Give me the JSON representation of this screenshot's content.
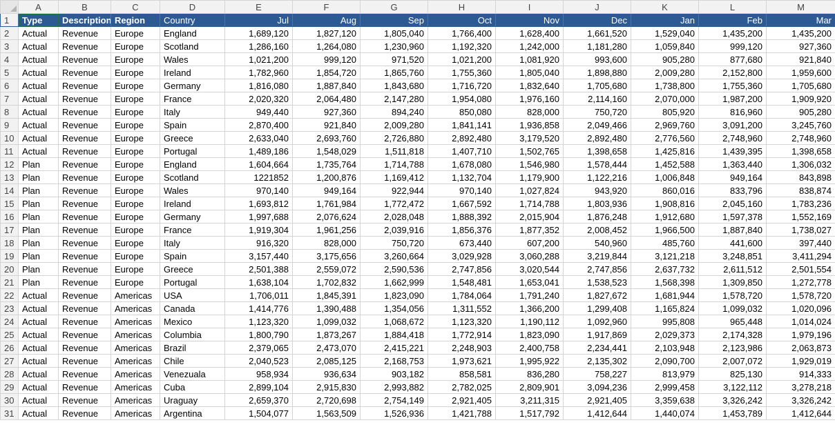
{
  "sheet": {
    "columns": [
      "A",
      "B",
      "C",
      "D",
      "E",
      "F",
      "G",
      "H",
      "I",
      "J",
      "K",
      "L",
      "M"
    ],
    "header": {
      "type": "Type",
      "description": "Description",
      "region": "Region",
      "country": "Country",
      "months": [
        "Jul",
        "Aug",
        "Sep",
        "Oct",
        "Nov",
        "Dec",
        "Jan",
        "Feb",
        "Mar"
      ]
    },
    "rows": [
      {
        "n": "2",
        "type": "Actual",
        "desc": "Revenue",
        "region": "Europe",
        "country": "England",
        "vals": [
          "1,689,120",
          "1,827,120",
          "1,805,040",
          "1,766,400",
          "1,628,400",
          "1,661,520",
          "1,529,040",
          "1,435,200",
          "1,435,200"
        ]
      },
      {
        "n": "3",
        "type": "Actual",
        "desc": "Revenue",
        "region": "Europe",
        "country": "Scotland",
        "vals": [
          "1,286,160",
          "1,264,080",
          "1,230,960",
          "1,192,320",
          "1,242,000",
          "1,181,280",
          "1,059,840",
          "999,120",
          "927,360"
        ]
      },
      {
        "n": "4",
        "type": "Actual",
        "desc": "Revenue",
        "region": "Europe",
        "country": "Wales",
        "vals": [
          "1,021,200",
          "999,120",
          "971,520",
          "1,021,200",
          "1,081,920",
          "993,600",
          "905,280",
          "877,680",
          "921,840"
        ]
      },
      {
        "n": "5",
        "type": "Actual",
        "desc": "Revenue",
        "region": "Europe",
        "country": "Ireland",
        "vals": [
          "1,782,960",
          "1,854,720",
          "1,865,760",
          "1,755,360",
          "1,805,040",
          "1,898,880",
          "2,009,280",
          "2,152,800",
          "1,959,600"
        ]
      },
      {
        "n": "6",
        "type": "Actual",
        "desc": "Revenue",
        "region": "Europe",
        "country": "Germany",
        "vals": [
          "1,816,080",
          "1,887,840",
          "1,843,680",
          "1,716,720",
          "1,832,640",
          "1,705,680",
          "1,738,800",
          "1,755,360",
          "1,705,680"
        ]
      },
      {
        "n": "7",
        "type": "Actual",
        "desc": "Revenue",
        "region": "Europe",
        "country": "France",
        "vals": [
          "2,020,320",
          "2,064,480",
          "2,147,280",
          "1,954,080",
          "1,976,160",
          "2,114,160",
          "2,070,000",
          "1,987,200",
          "1,909,920"
        ]
      },
      {
        "n": "8",
        "type": "Actual",
        "desc": "Revenue",
        "region": "Europe",
        "country": "Italy",
        "vals": [
          "949,440",
          "927,360",
          "894,240",
          "850,080",
          "828,000",
          "750,720",
          "805,920",
          "816,960",
          "905,280"
        ]
      },
      {
        "n": "9",
        "type": "Actual",
        "desc": "Revenue",
        "region": "Europe",
        "country": "Spain",
        "vals": [
          "2,870,400",
          "921,840",
          "2,009,280",
          "1,841,141",
          "1,936,858",
          "2,049,466",
          "2,969,760",
          "3,091,200",
          "3,245,760"
        ]
      },
      {
        "n": "10",
        "type": "Actual",
        "desc": "Revenue",
        "region": "Europe",
        "country": "Greece",
        "vals": [
          "2,633,040",
          "2,693,760",
          "2,726,880",
          "2,892,480",
          "3,179,520",
          "2,892,480",
          "2,776,560",
          "2,748,960",
          "2,748,960"
        ]
      },
      {
        "n": "11",
        "type": "Actual",
        "desc": "Revenue",
        "region": "Europe",
        "country": "Portugal",
        "vals": [
          "1,489,186",
          "1,548,029",
          "1,511,818",
          "1,407,710",
          "1,502,765",
          "1,398,658",
          "1,425,816",
          "1,439,395",
          "1,398,658"
        ]
      },
      {
        "n": "12",
        "type": "Plan",
        "desc": "Revenue",
        "region": "Europe",
        "country": "England",
        "vals": [
          "1,604,664",
          "1,735,764",
          "1,714,788",
          "1,678,080",
          "1,546,980",
          "1,578,444",
          "1,452,588",
          "1,363,440",
          "1,306,032"
        ]
      },
      {
        "n": "13",
        "type": "Plan",
        "desc": "Revenue",
        "region": "Europe",
        "country": "Scotland",
        "vals": [
          "1221852",
          "1,200,876",
          "1,169,412",
          "1,132,704",
          "1,179,900",
          "1,122,216",
          "1,006,848",
          "949,164",
          "843,898"
        ]
      },
      {
        "n": "14",
        "type": "Plan",
        "desc": "Revenue",
        "region": "Europe",
        "country": "Wales",
        "vals": [
          "970,140",
          "949,164",
          "922,944",
          "970,140",
          "1,027,824",
          "943,920",
          "860,016",
          "833,796",
          "838,874"
        ]
      },
      {
        "n": "15",
        "type": "Plan",
        "desc": "Revenue",
        "region": "Europe",
        "country": "Ireland",
        "vals": [
          "1,693,812",
          "1,761,984",
          "1,772,472",
          "1,667,592",
          "1,714,788",
          "1,803,936",
          "1,908,816",
          "2,045,160",
          "1,783,236"
        ]
      },
      {
        "n": "16",
        "type": "Plan",
        "desc": "Revenue",
        "region": "Europe",
        "country": "Germany",
        "vals": [
          "1,997,688",
          "2,076,624",
          "2,028,048",
          "1,888,392",
          "2,015,904",
          "1,876,248",
          "1,912,680",
          "1,597,378",
          "1,552,169"
        ]
      },
      {
        "n": "17",
        "type": "Plan",
        "desc": "Revenue",
        "region": "Europe",
        "country": "France",
        "vals": [
          "1,919,304",
          "1,961,256",
          "2,039,916",
          "1,856,376",
          "1,877,352",
          "2,008,452",
          "1,966,500",
          "1,887,840",
          "1,738,027"
        ]
      },
      {
        "n": "18",
        "type": "Plan",
        "desc": "Revenue",
        "region": "Europe",
        "country": "Italy",
        "vals": [
          "916,320",
          "828,000",
          "750,720",
          "673,440",
          "607,200",
          "540,960",
          "485,760",
          "441,600",
          "397,440"
        ]
      },
      {
        "n": "19",
        "type": "Plan",
        "desc": "Revenue",
        "region": "Europe",
        "country": "Spain",
        "vals": [
          "3,157,440",
          "3,175,656",
          "3,260,664",
          "3,029,928",
          "3,060,288",
          "3,219,844",
          "3,121,218",
          "3,248,851",
          "3,411,294"
        ]
      },
      {
        "n": "20",
        "type": "Plan",
        "desc": "Revenue",
        "region": "Europe",
        "country": "Greece",
        "vals": [
          "2,501,388",
          "2,559,072",
          "2,590,536",
          "2,747,856",
          "3,020,544",
          "2,747,856",
          "2,637,732",
          "2,611,512",
          "2,501,554"
        ]
      },
      {
        "n": "21",
        "type": "Plan",
        "desc": "Revenue",
        "region": "Europe",
        "country": "Portugal",
        "vals": [
          "1,638,104",
          "1,702,832",
          "1,662,999",
          "1,548,481",
          "1,653,041",
          "1,538,523",
          "1,568,398",
          "1,309,850",
          "1,272,778"
        ]
      },
      {
        "n": "22",
        "type": "Actual",
        "desc": "Revenue",
        "region": "Americas",
        "country": "USA",
        "vals": [
          "1,706,011",
          "1,845,391",
          "1,823,090",
          "1,784,064",
          "1,791,240",
          "1,827,672",
          "1,681,944",
          "1,578,720",
          "1,578,720"
        ]
      },
      {
        "n": "23",
        "type": "Actual",
        "desc": "Revenue",
        "region": "Americas",
        "country": "Canada",
        "vals": [
          "1,414,776",
          "1,390,488",
          "1,354,056",
          "1,311,552",
          "1,366,200",
          "1,299,408",
          "1,165,824",
          "1,099,032",
          "1,020,096"
        ]
      },
      {
        "n": "24",
        "type": "Actual",
        "desc": "Revenue",
        "region": "Americas",
        "country": "Mexico",
        "vals": [
          "1,123,320",
          "1,099,032",
          "1,068,672",
          "1,123,320",
          "1,190,112",
          "1,092,960",
          "995,808",
          "965,448",
          "1,014,024"
        ]
      },
      {
        "n": "25",
        "type": "Actual",
        "desc": "Revenue",
        "region": "Americas",
        "country": "Columbia",
        "vals": [
          "1,800,790",
          "1,873,267",
          "1,884,418",
          "1,772,914",
          "1,823,090",
          "1,917,869",
          "2,029,373",
          "2,174,328",
          "1,979,196"
        ]
      },
      {
        "n": "26",
        "type": "Actual",
        "desc": "Revenue",
        "region": "Americas",
        "country": "Brazil",
        "vals": [
          "2,379,065",
          "2,473,070",
          "2,415,221",
          "2,248,903",
          "2,400,758",
          "2,234,441",
          "2,103,948",
          "2,123,986",
          "2,063,873"
        ]
      },
      {
        "n": "27",
        "type": "Actual",
        "desc": "Revenue",
        "region": "Americas",
        "country": "Chile",
        "vals": [
          "2,040,523",
          "2,085,125",
          "2,168,753",
          "1,973,621",
          "1,995,922",
          "2,135,302",
          "2,090,700",
          "2,007,072",
          "1,929,019"
        ]
      },
      {
        "n": "28",
        "type": "Actual",
        "desc": "Revenue",
        "region": "Americas",
        "country": "Venezuala",
        "vals": [
          "958,934",
          "936,634",
          "903,182",
          "858,581",
          "836,280",
          "758,227",
          "813,979",
          "825,130",
          "914,333"
        ]
      },
      {
        "n": "29",
        "type": "Actual",
        "desc": "Revenue",
        "region": "Americas",
        "country": "Cuba",
        "vals": [
          "2,899,104",
          "2,915,830",
          "2,993,882",
          "2,782,025",
          "2,809,901",
          "3,094,236",
          "2,999,458",
          "3,122,112",
          "3,278,218"
        ]
      },
      {
        "n": "30",
        "type": "Actual",
        "desc": "Revenue",
        "region": "Americas",
        "country": "Uraguay",
        "vals": [
          "2,659,370",
          "2,720,698",
          "2,754,149",
          "2,921,405",
          "3,211,315",
          "2,921,405",
          "3,359,638",
          "3,326,242",
          "3,326,242"
        ]
      },
      {
        "n": "31",
        "type": "Actual",
        "desc": "Revenue",
        "region": "Americas",
        "country": "Argentina",
        "vals": [
          "1,504,077",
          "1,563,509",
          "1,526,936",
          "1,421,788",
          "1,517,792",
          "1,412,644",
          "1,440,074",
          "1,453,789",
          "1,412,644"
        ]
      }
    ]
  }
}
